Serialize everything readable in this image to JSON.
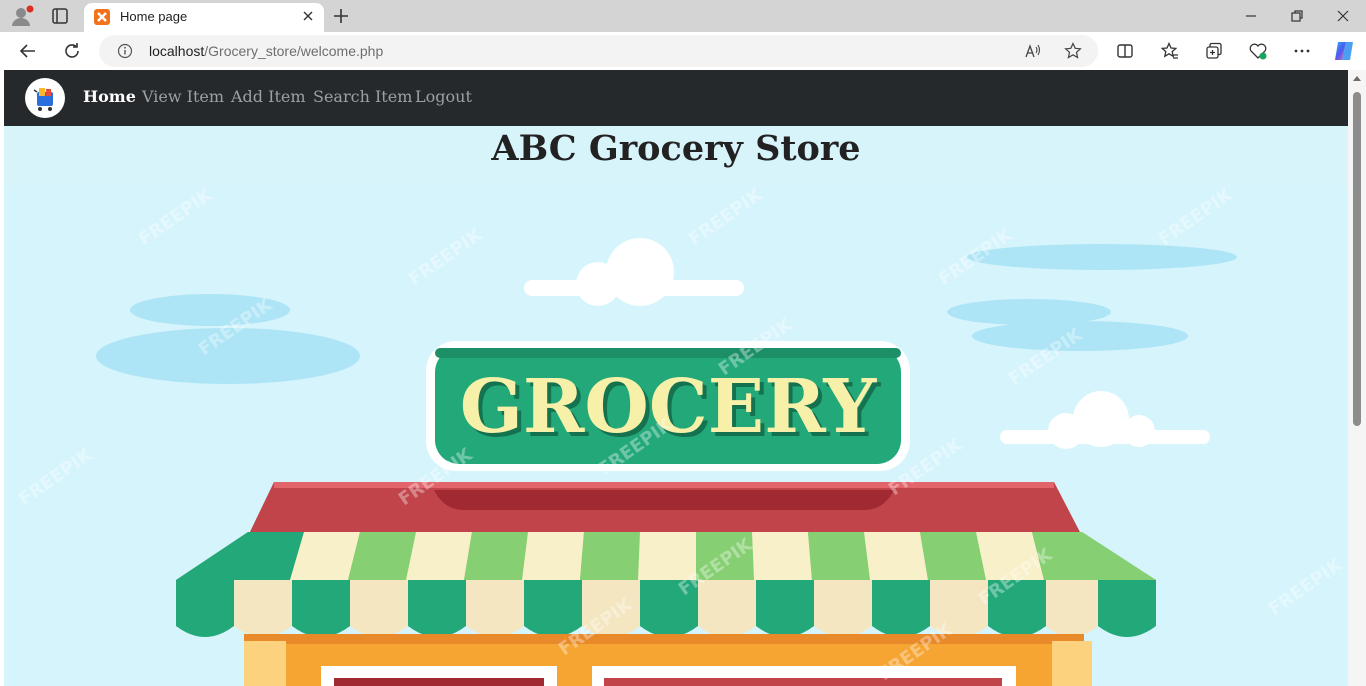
{
  "browser": {
    "tab_title": "Home page",
    "url_host": "localhost",
    "url_path": "/Grocery_store/welcome.php"
  },
  "navbar": {
    "links": [
      {
        "label": "Home"
      },
      {
        "label": "View Item"
      },
      {
        "label": "Add Item"
      },
      {
        "label": "Search Item"
      },
      {
        "label": "Logout"
      }
    ]
  },
  "page": {
    "title": "ABC Grocery Store"
  },
  "hero": {
    "sign_text": "GROCERY",
    "watermark": "FREEPIK"
  },
  "colors": {
    "navbar_bg": "#25292c",
    "page_bg": "#d8f4fb",
    "sign_green": "#23a87a",
    "sign_text": "#f7f0a8",
    "awning_red": "#c0444a",
    "stripe_green": "#23a87a",
    "stripe_light_green": "#86cf72",
    "stripe_cream": "#f8f0c8",
    "shop_orange": "#f6a533"
  },
  "icons": {
    "favicon": "xampp-icon",
    "omnibox_info": "info-icon",
    "read_aloud": "read-aloud-icon",
    "favorite": "star-icon"
  }
}
